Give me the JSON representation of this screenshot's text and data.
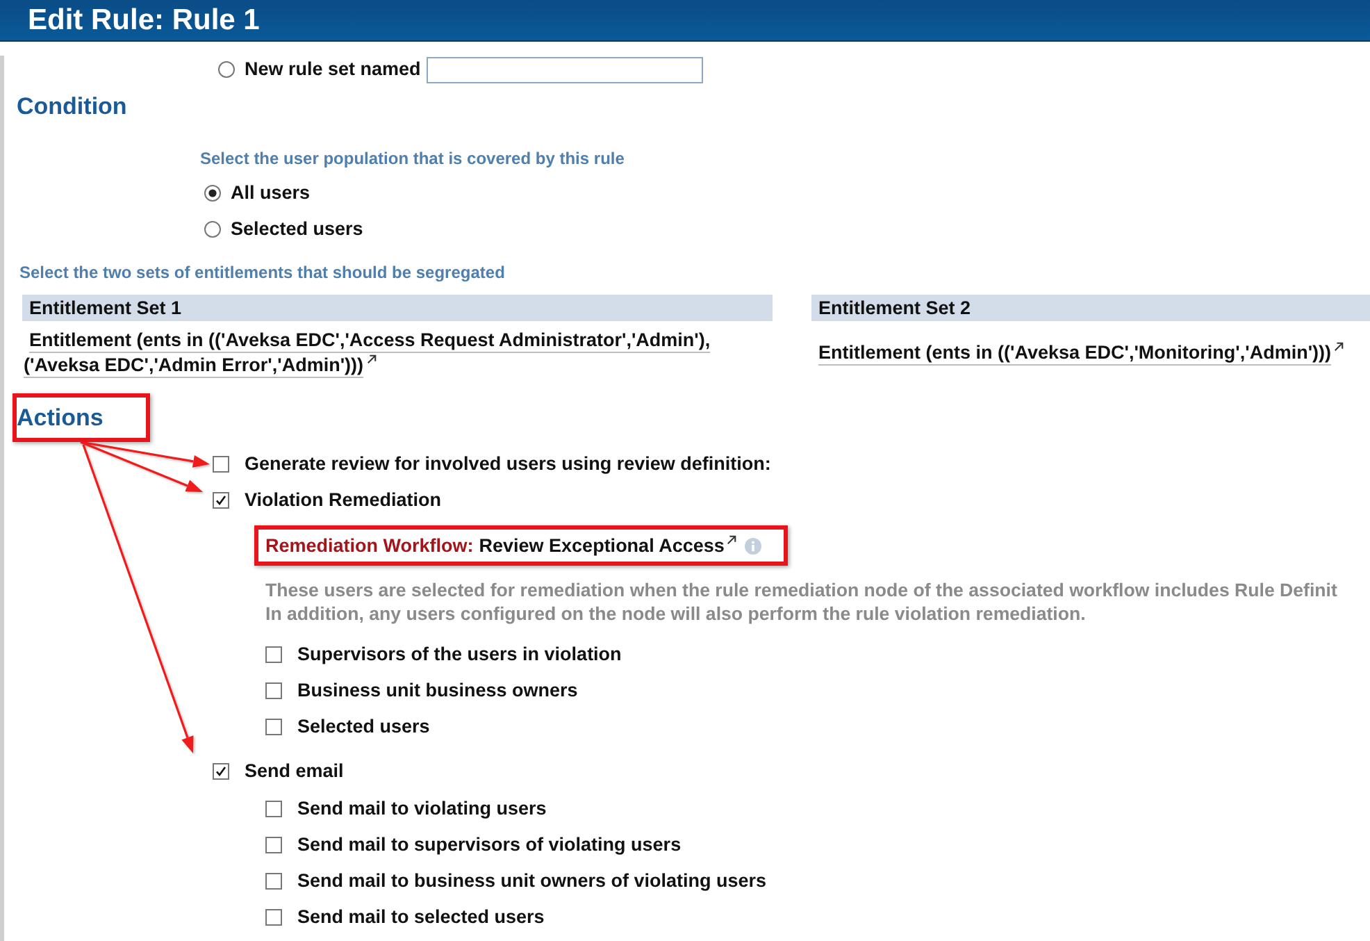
{
  "window": {
    "title": "Edit Rule: Rule 1"
  },
  "rule_set": {
    "new_option": {
      "label": "New rule set named",
      "selected": false
    }
  },
  "condition": {
    "heading": "Condition",
    "population": {
      "prompt": "Select the user population that is covered by this rule",
      "options": [
        {
          "label": "All users",
          "selected": true
        },
        {
          "label": "Selected users",
          "selected": false
        }
      ]
    },
    "entitlements": {
      "prompt": "Select the two sets of entitlements that should be segregated",
      "sets": [
        {
          "title": "Entitlement Set 1",
          "expression": "Entitlement (ents in (('Aveksa EDC','Access Request Administrator','Admin'), ('Aveksa EDC','Admin Error','Admin')))"
        },
        {
          "title": "Entitlement Set 2",
          "expression": "Entitlement (ents in (('Aveksa EDC','Monitoring','Admin')))"
        }
      ]
    }
  },
  "actions": {
    "heading": "Actions",
    "items": [
      {
        "label": "Generate review for involved users using review definition:",
        "checked": false
      },
      {
        "label": "Violation Remediation",
        "checked": true,
        "workflow": {
          "label": "Remediation Workflow:",
          "value": "Review Exceptional Access"
        },
        "note": [
          "These users are selected for remediation when the rule remediation node of the associated workflow includes Rule Definit",
          "In addition, any users configured on the node will also perform the rule violation remediation."
        ],
        "children": [
          {
            "label": "Supervisors of the users in violation",
            "checked": false
          },
          {
            "label": "Business unit business owners",
            "checked": false
          },
          {
            "label": "Selected users",
            "checked": false
          }
        ]
      },
      {
        "label": "Send email",
        "checked": true,
        "children": [
          {
            "label": "Send mail to violating users",
            "checked": false
          },
          {
            "label": "Send mail to supervisors of violating users",
            "checked": false
          },
          {
            "label": "Send mail to business unit owners of violating users",
            "checked": false
          },
          {
            "label": "Send mail to selected users",
            "checked": false
          }
        ]
      }
    ]
  }
}
